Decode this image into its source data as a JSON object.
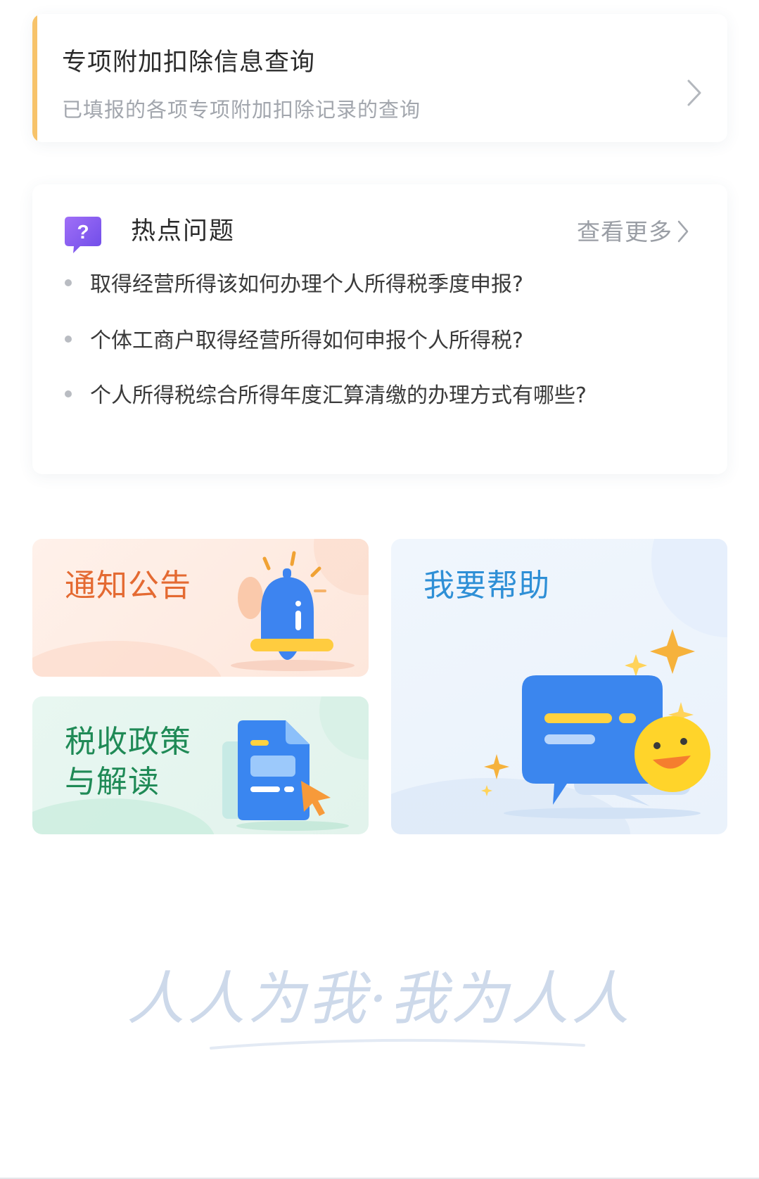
{
  "deduction": {
    "title": "专项附加扣除信息查询",
    "subtitle": "已填报的各项专项附加扣除记录的查询"
  },
  "faq": {
    "icon_glyph": "?",
    "title": "热点问题",
    "more_label": "查看更多",
    "items": [
      "取得经营所得该如何办理个人所得税季度申报?",
      "个体工商户取得经营所得如何申报个人所得税?",
      "个人所得税综合所得年度汇算清缴的办理方式有哪些?"
    ]
  },
  "tiles": {
    "notice": "通知公告",
    "policy_line1": "税收政策",
    "policy_line2": "与解读",
    "help": "我要帮助"
  },
  "slogan": "人人为我·我为人人",
  "colors": {
    "accent_bar": "#f7c36a",
    "notice_text": "#e46a32",
    "policy_text": "#1f8a56",
    "help_text": "#2e8fd6",
    "faq_icon": "#8b5cf6"
  }
}
